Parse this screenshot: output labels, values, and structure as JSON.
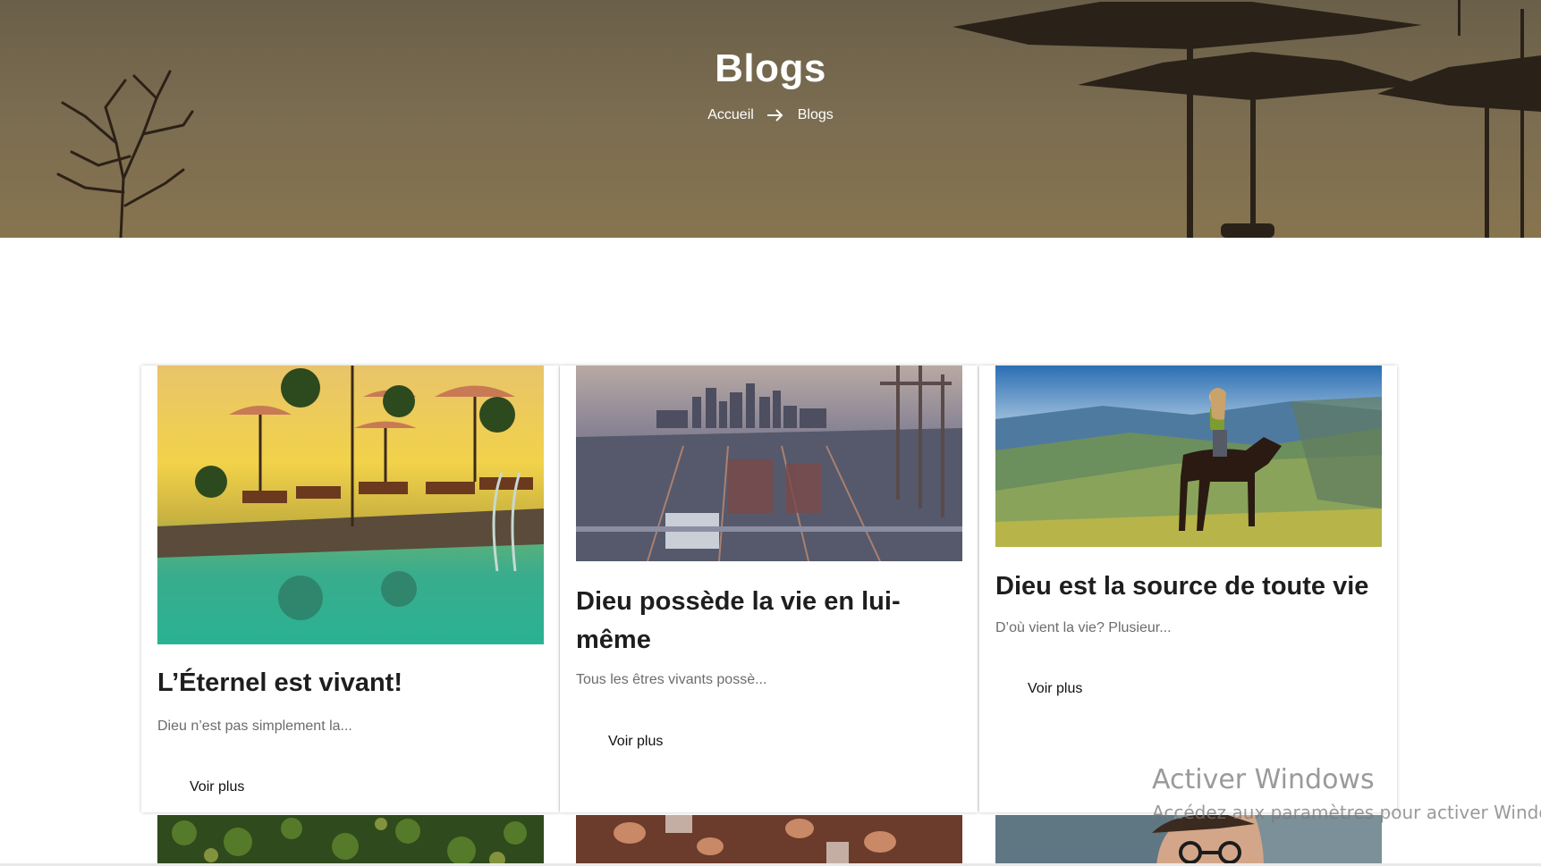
{
  "hero": {
    "title": "Blogs",
    "breadcrumb": {
      "home": "Accueil",
      "separator_icon": "arrow-right-icon",
      "current": "Blogs"
    }
  },
  "posts": [
    {
      "title": "L’Éternel est vivant!",
      "excerpt": "Dieu n’est pas simplement la...",
      "link_label": "Voir plus",
      "image": "resort-pool-sunset-photo"
    },
    {
      "title": "Dieu possède la vie en lui-même",
      "excerpt": "Tous les êtres vivants possè...",
      "link_label": "Voir plus",
      "image": "city-port-containers-photo"
    },
    {
      "title": "Dieu est la source de toute vie",
      "excerpt": "D’où vient la vie? Plusieur...",
      "link_label": "Voir plus",
      "image": "horse-rider-mountains-photo"
    }
  ],
  "next_row_images": [
    "forest-aerial-photo",
    "crowd-hands-photo",
    "man-glasses-portrait-photo"
  ],
  "watermark": {
    "title": "Activer Windows",
    "subtitle": "Accédez aux paramètres pour activer Windows."
  },
  "colors": {
    "hero_overlay": "#7a6c50",
    "title_text": "#1e1e1e",
    "excerpt_text": "#6c6c6c"
  }
}
